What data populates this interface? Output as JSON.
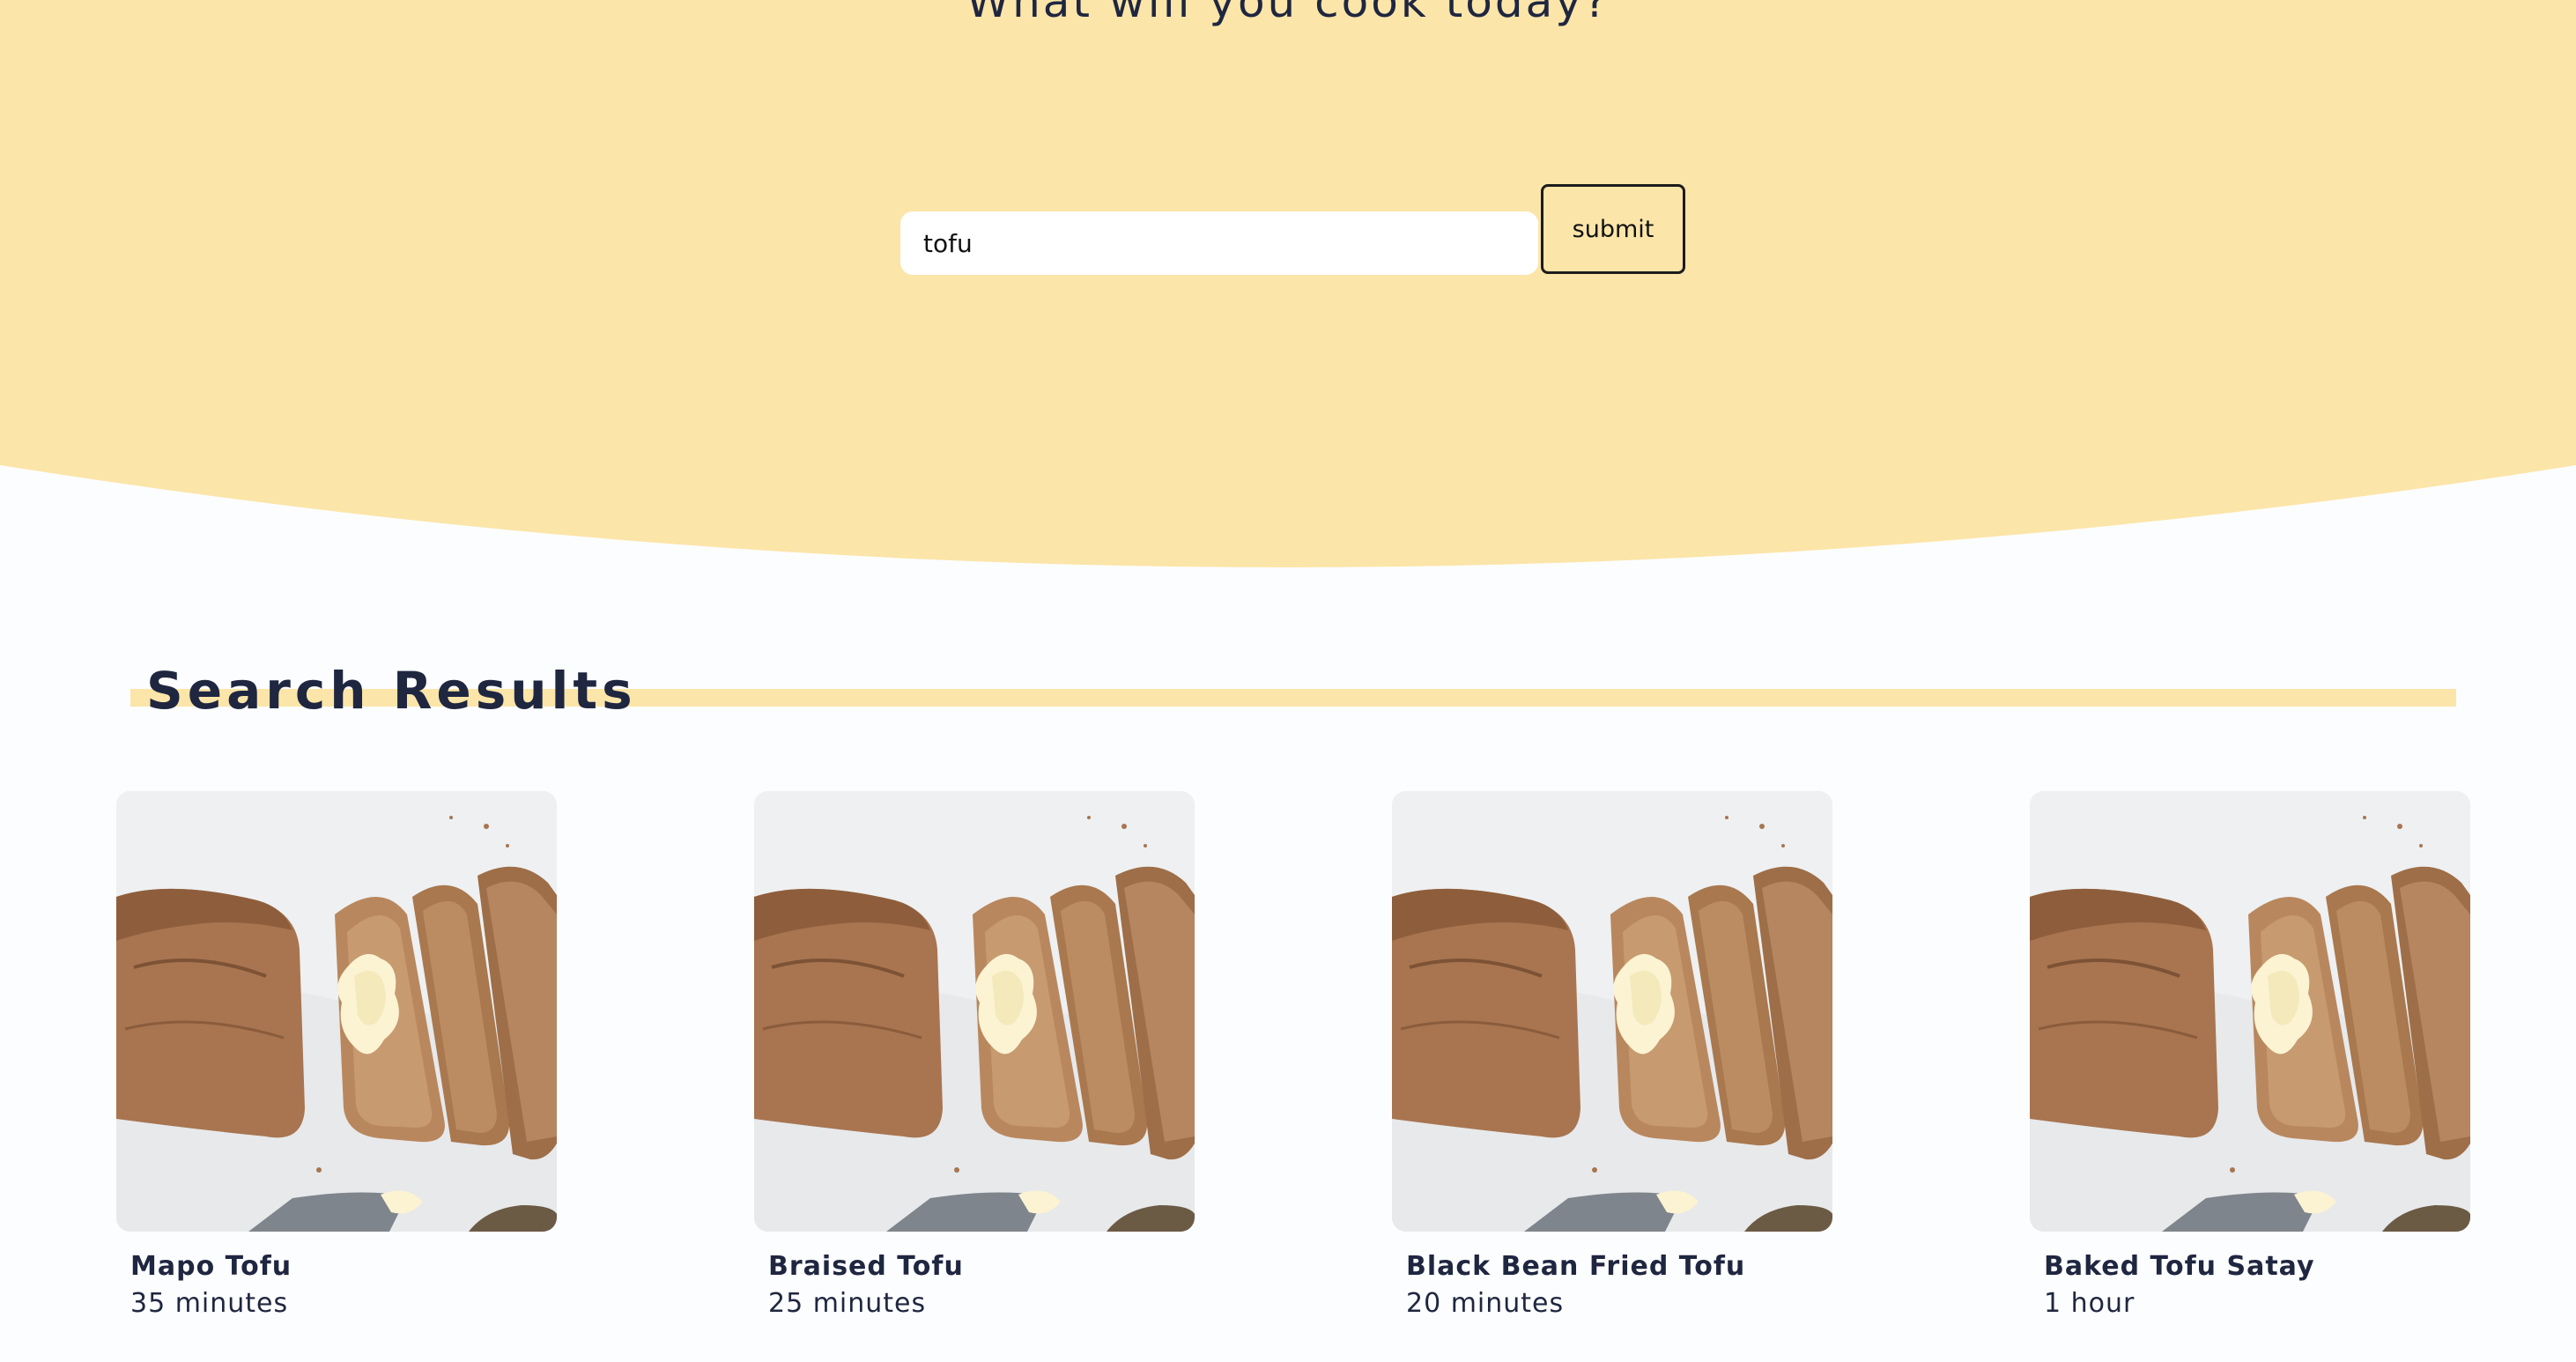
{
  "hero": {
    "title": "What will you cook today?",
    "background_color": "#fbe5a8"
  },
  "search": {
    "value": "tofu",
    "submit_label": "submit"
  },
  "results": {
    "heading": "Search Results",
    "accent_color": "#fbe5a8",
    "items": [
      {
        "title": "Mapo Tofu",
        "time": "35 minutes",
        "image": "banana-bread-photo"
      },
      {
        "title": "Braised Tofu",
        "time": "25 minutes",
        "image": "banana-bread-photo"
      },
      {
        "title": "Black Bean Fried Tofu",
        "time": "20 minutes",
        "image": "banana-bread-photo"
      },
      {
        "title": "Baked Tofu Satay",
        "time": "1 hour",
        "image": "banana-bread-photo"
      }
    ]
  }
}
